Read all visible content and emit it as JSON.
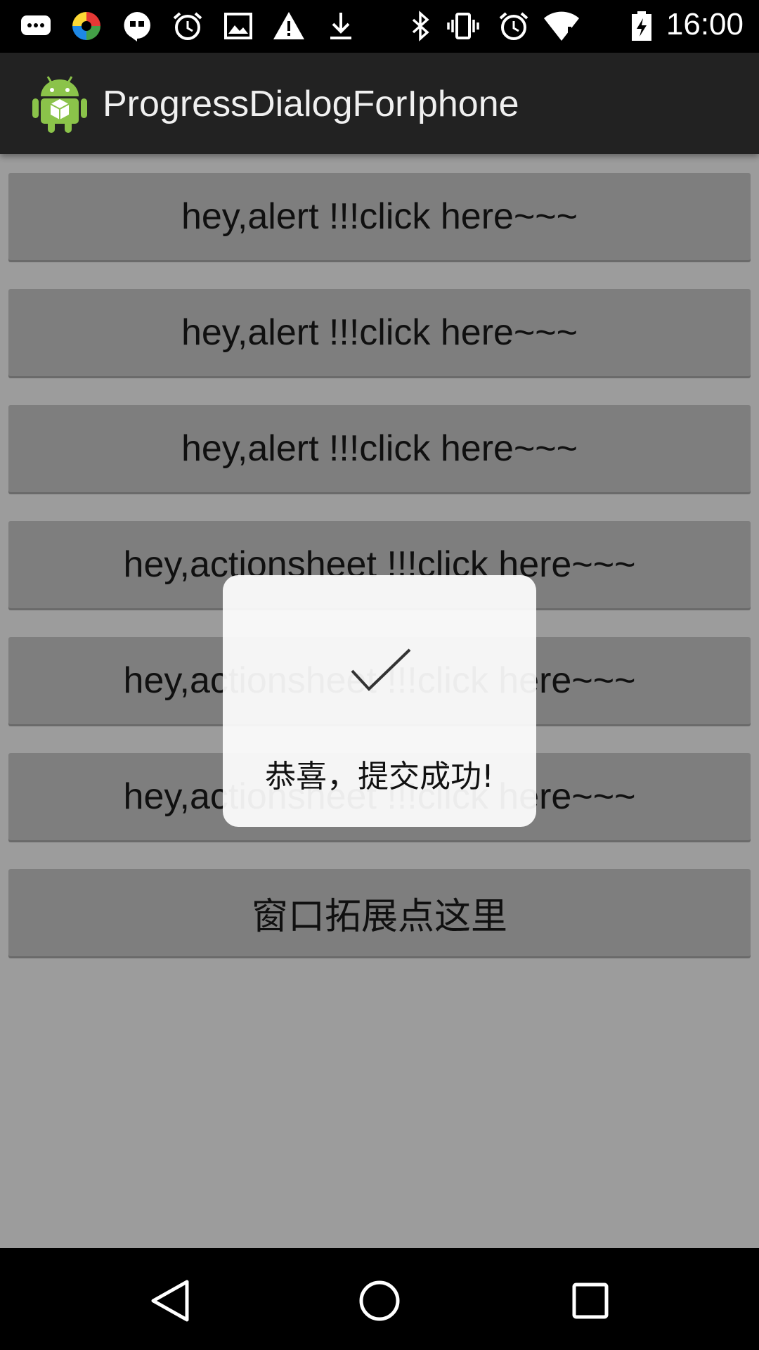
{
  "status_bar": {
    "time": "16:00",
    "left_icons": [
      "chat-bubble-icon",
      "pinwheel-icon",
      "hangouts-icon",
      "alarm-icon",
      "image-icon",
      "warning-icon",
      "download-icon"
    ],
    "right_icons": [
      "bluetooth-icon",
      "vibrate-icon",
      "alarm-icon",
      "wifi-icon",
      "battery-icon"
    ]
  },
  "action_bar": {
    "title": "ProgressDialogForIphone",
    "app_icon": "android-robot-icon"
  },
  "buttons": [
    {
      "label": "hey,alert !!!click here~~~"
    },
    {
      "label": "hey,alert !!!click here~~~"
    },
    {
      "label": "hey,alert !!!click here~~~"
    },
    {
      "label": "hey,actionsheet !!!click here~~~"
    },
    {
      "label": "hey,actionsheet !!!click here~~~"
    },
    {
      "label": "hey,actionsheet !!!click here~~~"
    },
    {
      "label": "窗口拓展点这里"
    }
  ],
  "toast": {
    "icon": "checkmark-icon",
    "message": "恭喜，提交成功!"
  },
  "nav_bar": {
    "buttons": [
      "back-icon",
      "home-icon",
      "recents-icon"
    ]
  },
  "colors": {
    "background": "#9c9c9c",
    "button": "#7e7e7e",
    "action_bar": "#222222"
  }
}
